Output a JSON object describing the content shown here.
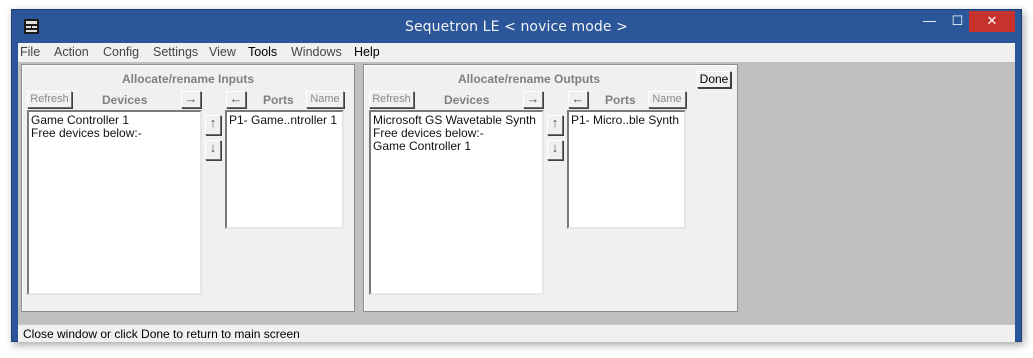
{
  "window": {
    "title": "Sequetron LE  < novice mode >"
  },
  "menu": [
    {
      "label": "File"
    },
    {
      "label": "Action"
    },
    {
      "label": "Config"
    },
    {
      "label": "Settings"
    },
    {
      "label": "View"
    },
    {
      "label": "Tools"
    },
    {
      "label": "Windows"
    },
    {
      "label": "Help"
    }
  ],
  "inputs": {
    "title": "Allocate/rename Inputs",
    "refresh_label": "Refresh",
    "devices_label": "Devices",
    "ports_label": "Ports",
    "name_label": "Name",
    "devices_list": [
      "Game Controller 1",
      "Free devices below:-"
    ],
    "ports_list": [
      "P1- Game..ntroller 1"
    ]
  },
  "outputs": {
    "title": "Allocate/rename Outputs",
    "done_label": "Done",
    "refresh_label": "Refresh",
    "devices_label": "Devices",
    "ports_label": "Ports",
    "name_label": "Name",
    "devices_list": [
      "Microsoft GS Wavetable Synth",
      "Free devices below:-",
      "Game Controller 1"
    ],
    "ports_list": [
      "P1- Micro..ble Synth"
    ]
  },
  "status": {
    "text": "Close window or click Done to return to main screen"
  },
  "icons": {
    "arrow_right": "→",
    "arrow_left": "←",
    "arrow_up": "↑",
    "arrow_down": "↓",
    "minimize": "—",
    "maximize": "☐",
    "close": "✕"
  },
  "colors": {
    "titlebar": "#2b579a",
    "close_button": "#c7332c",
    "panel": "#f0f0f0"
  }
}
